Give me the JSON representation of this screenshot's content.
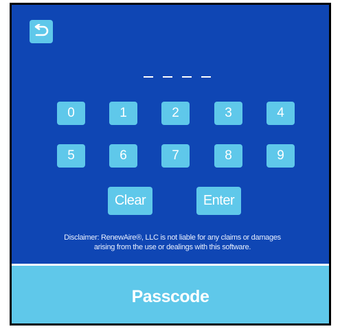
{
  "header": {
    "back_icon": "undo-arrow-icon"
  },
  "passcode_display": {
    "placeholder": "_ _ _ _",
    "slots": 4
  },
  "keypad": {
    "digits": [
      "0",
      "1",
      "2",
      "3",
      "4",
      "5",
      "6",
      "7",
      "8",
      "9"
    ],
    "clear_label": "Clear",
    "enter_label": "Enter"
  },
  "disclaimer": {
    "line1": "Disclaimer: RenewAire®, LLC is not liable for any claims or damages",
    "line2": "arising from the use or dealings with this software."
  },
  "footer": {
    "title": "Passcode"
  },
  "colors": {
    "background": "#0f46b4",
    "button": "#5fc8ea",
    "text": "#ffffff"
  }
}
